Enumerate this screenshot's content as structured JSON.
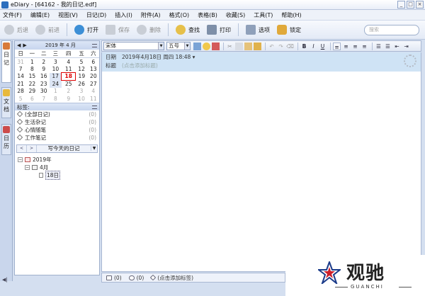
{
  "window": {
    "title": "eDiary - [64162 - 我的日记.edf]",
    "controls": [
      "_",
      "□",
      "×"
    ]
  },
  "menu": [
    "文件(F)",
    "编辑(E)",
    "视图(V)",
    "日记(D)",
    "插入(I)",
    "附件(A)",
    "格式(O)",
    "表格(B)",
    "收藏(S)",
    "工具(T)",
    "帮助(H)"
  ],
  "toolbar": {
    "back": "后退",
    "forward": "前进",
    "open": "打开",
    "save": "保存",
    "delete": "删除",
    "find": "查找",
    "print": "打印",
    "options": "选项",
    "lock": "锁定",
    "search_placeholder": "搜索"
  },
  "vtabs": [
    "日记",
    "文档",
    "日历"
  ],
  "calendar": {
    "prev": "◀",
    "next": "▶",
    "title": "2019 年 4 月",
    "weekdays": [
      "日",
      "一",
      "二",
      "三",
      "四",
      "五",
      "六"
    ],
    "weeks": [
      [
        "31",
        "1",
        "2",
        "3",
        "4",
        "5",
        "6"
      ],
      [
        "7",
        "8",
        "9",
        "10",
        "11",
        "12",
        "13"
      ],
      [
        "14",
        "15",
        "16",
        "17",
        "18",
        "19",
        "20"
      ],
      [
        "21",
        "22",
        "23",
        "24",
        "25",
        "26",
        "27"
      ],
      [
        "28",
        "29",
        "30",
        "1",
        "2",
        "3",
        "4"
      ],
      [
        "5",
        "6",
        "7",
        "8",
        "9",
        "10",
        "11"
      ]
    ]
  },
  "tags": {
    "header": "标签:",
    "items": [
      {
        "label": "(全部日记)",
        "count": "(0)"
      },
      {
        "label": "生活杂记",
        "count": "(0)"
      },
      {
        "label": "心情随笔",
        "count": "(0)"
      },
      {
        "label": "工作笔记",
        "count": "(0)"
      }
    ]
  },
  "write_today": {
    "prev": "<",
    "next": ">",
    "label": "写今天的日记",
    "dropdown": "▼"
  },
  "tree": {
    "year": "2019年",
    "month": "4月",
    "day": "18日",
    "collapse": "−"
  },
  "editor": {
    "font": "宋体",
    "size": "五号",
    "bold": "B",
    "italic": "I",
    "underline": "U"
  },
  "entry": {
    "date_key": "日期",
    "date_value": "2019年4月18日 周四 18:48 ▾",
    "title_key": "标题",
    "title_hint": "(点击添加标题)"
  },
  "status": {
    "attachments": "(0)",
    "comments": "(0)",
    "tags_hint": "(点击添加标签)"
  },
  "bottom_left": "◀|",
  "watermark": {
    "cn": "观驰",
    "en": "GUANCHI"
  },
  "colors": {
    "accent": "#2c6fbe",
    "today": "#dd0000",
    "date_panel": "#cfe3f5",
    "chrome": "#d4dff0"
  }
}
